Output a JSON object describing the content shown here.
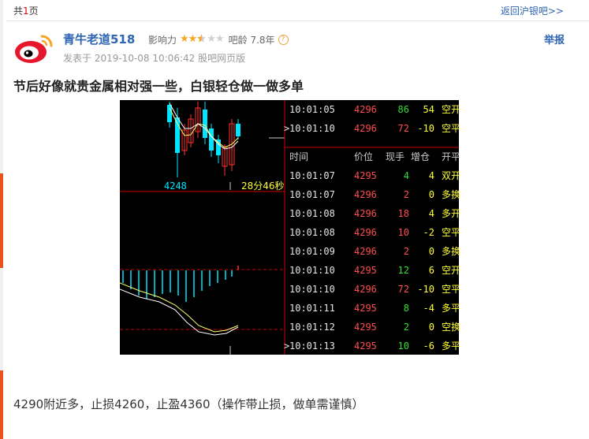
{
  "nav": {
    "page_prefix": "共",
    "page_num": "1",
    "page_suffix": "页",
    "back_link": "返回沪银吧>>"
  },
  "post": {
    "author": "青牛老道518",
    "influence_label": "影响力",
    "influence_stars": 2.5,
    "influence_max": 5,
    "bar_age": "吧龄 7.8年",
    "posted": "发表于 2019-10-08 10:06:42 股吧网页版",
    "report_label": "举报",
    "title": "节后好像就贵金属相对强一些，白银轻仓做一做多单",
    "body": "4290附近多，止损4260，止盈4360（操作带止损，做单需谨慎）"
  },
  "chart_labels": {
    "price_label": "4248",
    "countdown": "28分46秒"
  },
  "trade_panel": {
    "top_rows": [
      {
        "time": "10:01:05",
        "price": "4296",
        "vol": "86",
        "vol_color": "#33dd33",
        "oi": "54",
        "type": "空开",
        "selected": false
      },
      {
        "time": "10:01:10",
        "price": "4296",
        "vol": "72",
        "vol_color": "#ff4d4d",
        "oi": "-10",
        "type": "空平",
        "selected": true
      }
    ],
    "headers": {
      "time": "时间",
      "price": "价位",
      "vol": "现手",
      "oi": "增仓",
      "type": "开平"
    },
    "rows": [
      {
        "time": "10:01:07",
        "price": "4295",
        "vol": "4",
        "vol_color": "#33dd33",
        "oi": "4",
        "type": "双开",
        "selected": false
      },
      {
        "time": "10:01:07",
        "price": "4296",
        "vol": "2",
        "vol_color": "#ff4d4d",
        "oi": "0",
        "type": "多换",
        "selected": false
      },
      {
        "time": "10:01:08",
        "price": "4296",
        "vol": "18",
        "vol_color": "#ff4d4d",
        "oi": "4",
        "type": "多开",
        "selected": false
      },
      {
        "time": "10:01:08",
        "price": "4296",
        "vol": "10",
        "vol_color": "#ff4d4d",
        "oi": "-2",
        "type": "空平",
        "selected": false
      },
      {
        "time": "10:01:09",
        "price": "4296",
        "vol": "2",
        "vol_color": "#ff4d4d",
        "oi": "0",
        "type": "多换",
        "selected": false
      },
      {
        "time": "10:01:10",
        "price": "4295",
        "vol": "12",
        "vol_color": "#33dd33",
        "oi": "6",
        "type": "空开",
        "selected": false
      },
      {
        "time": "10:01:10",
        "price": "4296",
        "vol": "72",
        "vol_color": "#ff4d4d",
        "oi": "-10",
        "type": "空平",
        "selected": false
      },
      {
        "time": "10:01:11",
        "price": "4295",
        "vol": "8",
        "vol_color": "#33dd33",
        "oi": "-4",
        "type": "多平",
        "selected": false
      },
      {
        "time": "10:01:12",
        "price": "4295",
        "vol": "2",
        "vol_color": "#33dd33",
        "oi": "0",
        "type": "空换",
        "selected": false
      },
      {
        "time": "10:01:13",
        "price": "4295",
        "vol": "10",
        "vol_color": "#33dd33",
        "oi": "-6",
        "type": "多平",
        "selected": true
      }
    ]
  },
  "colors": {
    "link": "#2d64b3",
    "up": "#ff4d4d",
    "down": "#33dd33",
    "accent": "#ffff33"
  }
}
